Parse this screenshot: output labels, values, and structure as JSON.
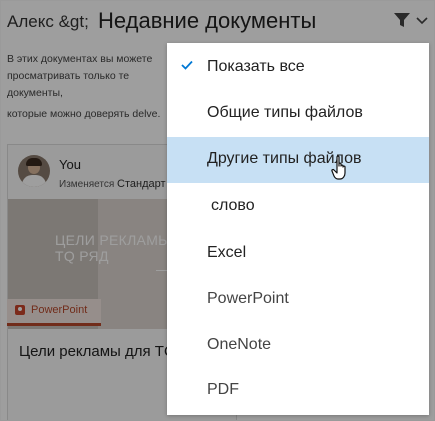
{
  "header": {
    "breadcrumb": "Алекс &gt;",
    "title": "Недавние документы"
  },
  "description": {
    "line1": "В этих документах вы можете",
    "line2": "просматривать только те документы,",
    "line3": "которые можно доверять delve."
  },
  "card": {
    "author": "You",
    "modified_prefix": "Изменяется",
    "modified_place": "Стандарт",
    "thumbnail_text": "ЦЕЛИ РЕКЛАМЫ ДЛЯ ТQ РЯД",
    "app_label": "PowerPoint",
    "title": "Цели рекламы для ТQ"
  },
  "menu": {
    "items": [
      {
        "label": "Показать все",
        "checked": true
      },
      {
        "label": "Общие типы файлов"
      },
      {
        "label": "Другие типы файлов",
        "highlighted": true
      },
      {
        "label": "слово"
      },
      {
        "label": "Excel"
      },
      {
        "label": "PowerPoint"
      },
      {
        "label": "OneNote"
      },
      {
        "label": "PDF"
      }
    ]
  },
  "icons": {
    "filter": "filter-icon",
    "chevron": "chevron-down-icon",
    "check": "checkmark-icon",
    "cursor": "hand-pointer-icon",
    "powerpoint": "powerpoint-icon"
  },
  "colors": {
    "highlight": "#c7e0f4",
    "check": "#0078d4",
    "powerpoint": "#b7472a",
    "overlay": "rgba(0,0,0,0.38)"
  }
}
